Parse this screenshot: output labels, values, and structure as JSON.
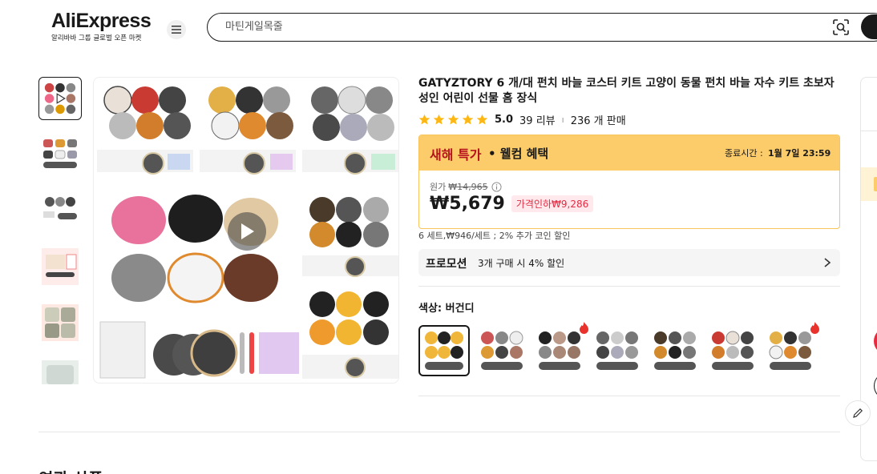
{
  "header": {
    "logo_text": "AliExpress",
    "logo_sub": "알리바바 그룹 글로벌 오픈 마켓",
    "search_placeholder": "마틴게일목줄"
  },
  "product": {
    "title": "GATYZTORY 6 개/대 펀치 바늘 코스터 키트 고양이 동물 펀치 바늘 자수 키트 초보자 성인 어린이 선물 홈 장식",
    "rating": "5.0",
    "reviews": "39 리뷰",
    "sold": "236 개 판매",
    "rating_stars": 5
  },
  "deal": {
    "label_red": "새해 특가",
    "label_rest": "• 웰컴 혜택",
    "end_label": "종료시간 :",
    "end_time": "1월 7일 23:59",
    "orig_label": "원가",
    "orig_price": "₩14,965",
    "price": "₩5,679",
    "discount": "가격인하₩9,286"
  },
  "coin_note": "6 세트,₩946/세트 ; 2% 추가 코인 할인",
  "promotion": {
    "label": "프로모션",
    "text": "3개 구매 시 4% 할인"
  },
  "color": {
    "label": "색상: 버건디",
    "swatch_count": 7,
    "selected_index": 0,
    "hot_indexes": [
      2,
      6
    ]
  },
  "related_title": "연관 상품",
  "colors": {
    "accent_red": "#e32a42",
    "promo_yellow": "#fccb6a",
    "star": "#fdb714",
    "newyear_red": "#b6121d"
  }
}
